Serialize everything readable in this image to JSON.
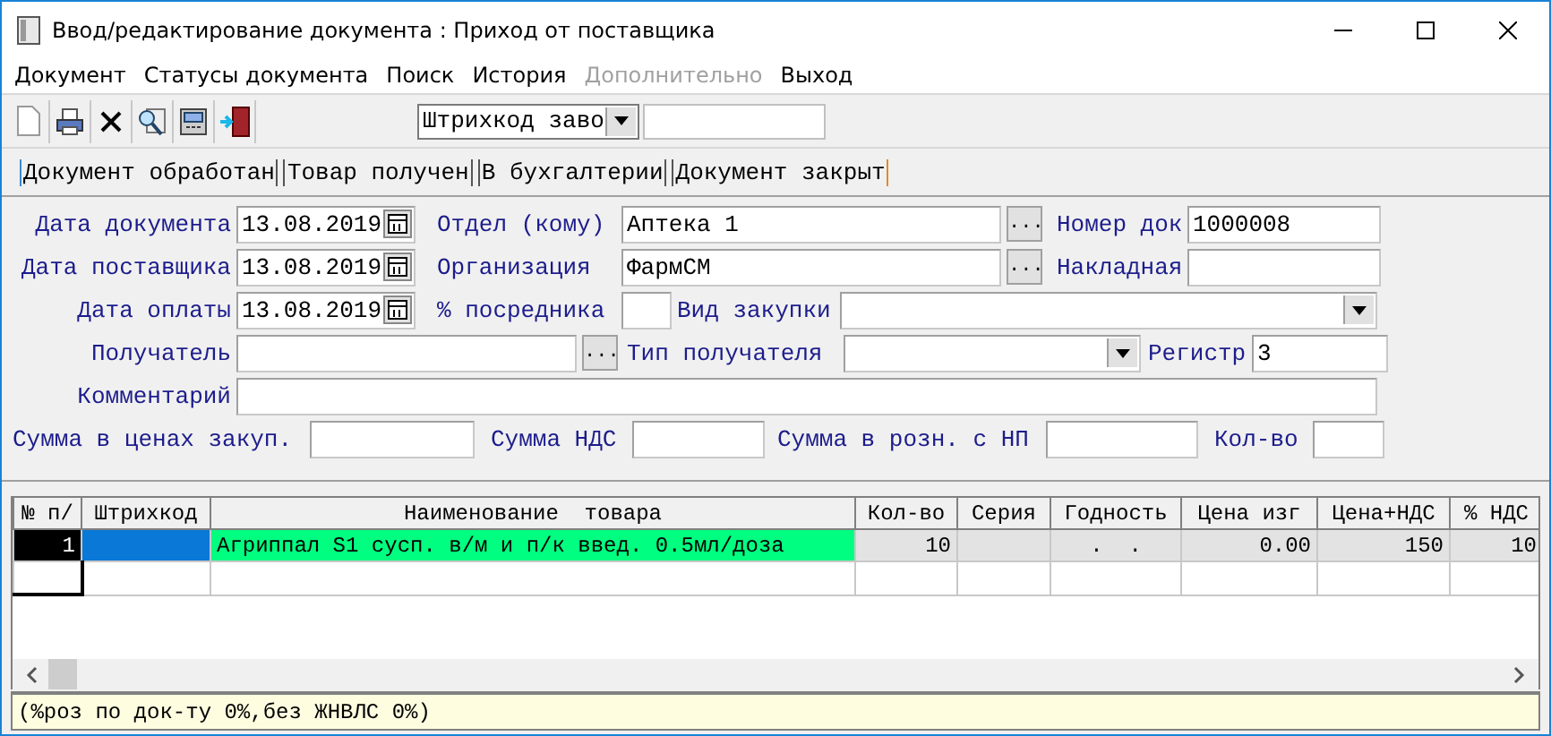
{
  "window": {
    "title": "Ввод/редактирование документа : Приход от поставщика"
  },
  "menu": [
    {
      "label": "Документ",
      "disabled": false
    },
    {
      "label": "Статусы документа",
      "disabled": false
    },
    {
      "label": "Поиск",
      "disabled": false
    },
    {
      "label": "История",
      "disabled": false
    },
    {
      "label": "Дополнительно",
      "disabled": true
    },
    {
      "label": "Выход",
      "disabled": false
    }
  ],
  "toolbar": {
    "search_mode": {
      "value": "Штрихкод заво"
    }
  },
  "status_buttons": [
    "Документ обработан ",
    "Товар получен",
    "В бухгалтерии",
    "Документ закрыт"
  ],
  "form": {
    "document_date": {
      "label": "Дата документа",
      "value": "13.08.2019"
    },
    "department": {
      "label": "Отдел (кому)",
      "value": "Аптека 1",
      "button": "..."
    },
    "doc_number": {
      "label": "Номер док",
      "value": "1000008"
    },
    "supplier_date": {
      "label": "Дата поставщика",
      "value": "13.08.2019"
    },
    "organization": {
      "label": "Организация",
      "value": "ФармСМ",
      "button": "..."
    },
    "invoice": {
      "label": "Накладная"
    },
    "payment_date": {
      "label": "Дата оплаты",
      "value": "13.08.2019"
    },
    "agent_percent": {
      "label": "% посредника"
    },
    "purchase_type": {
      "label": "Вид закупки"
    },
    "recipient": {
      "label": "Получатель",
      "button": "..."
    },
    "recipient_type": {
      "label": "Тип получателя"
    },
    "register": {
      "label": "Регистр",
      "value": "3"
    },
    "comment": {
      "label": "Комментарий"
    },
    "sum_purchase": {
      "label": "Сумма в ценах закуп."
    },
    "sum_vat": {
      "label": "Сумма НДС"
    },
    "sum_retail": {
      "label": "Сумма в розн. с НП"
    },
    "quantity": {
      "label": "Кол-во"
    }
  },
  "table": {
    "columns": [
      "№ п/",
      "Штрихкод",
      "Наименование  товара",
      "Кол-во",
      "Серия",
      "Годность",
      "Цена изг",
      "Цена+НДС",
      "% НДС"
    ],
    "rows": [
      {
        "selected": true,
        "color": "#00ff80",
        "number": "1",
        "name": "Агриппал S1 сусп. в/м и п/к введ. 0.5мл/доза",
        "quantity": "10",
        "expiry": ".  .",
        "price_mfr": "0.00",
        "price_vat": "150",
        "vat_percent": "10"
      }
    ]
  },
  "footer": "(%роз по док-ту 0%,без ЖНВЛС 0%)"
}
